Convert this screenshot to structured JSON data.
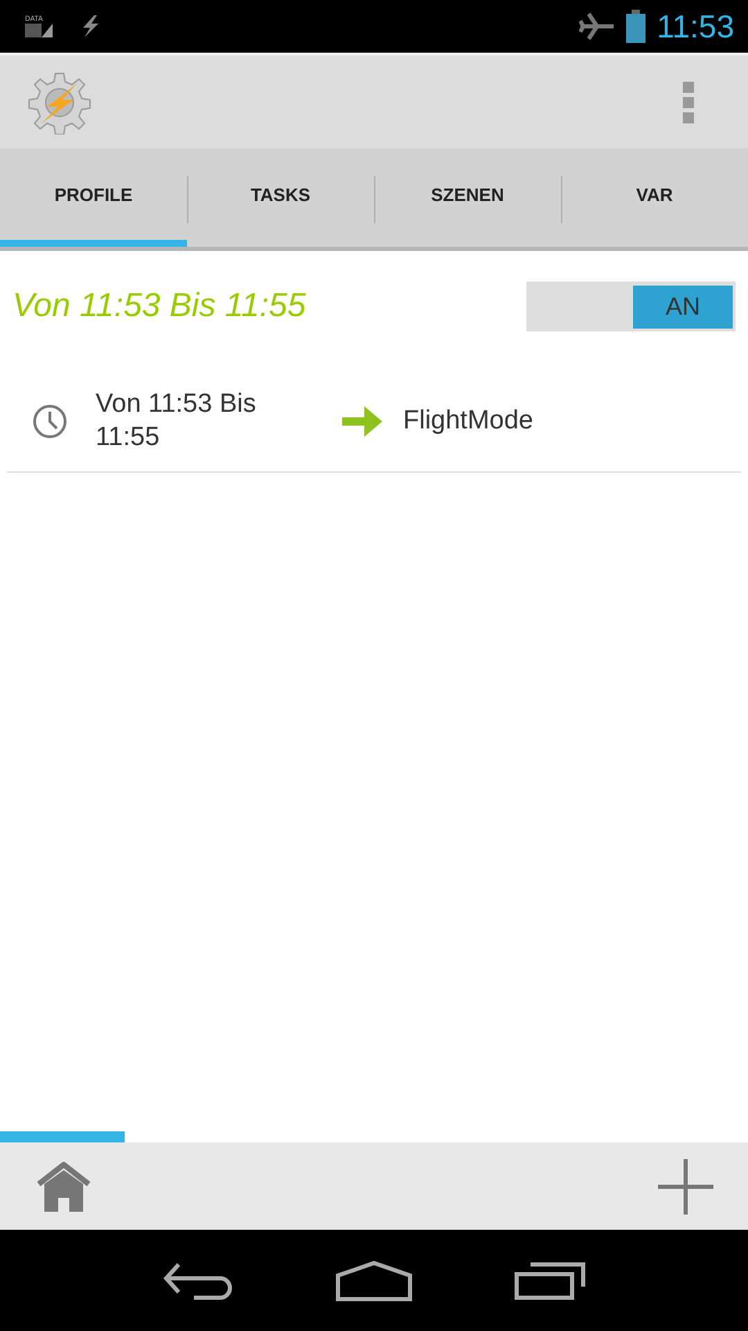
{
  "status_bar": {
    "data_label": "DATA",
    "time": "11:53"
  },
  "tabs": [
    {
      "label": "PROFILE",
      "selected": true
    },
    {
      "label": "TASKS",
      "selected": false
    },
    {
      "label": "SZENEN",
      "selected": false
    },
    {
      "label": "VAR",
      "selected": false
    }
  ],
  "profile": {
    "title": "Von 11:53 Bis 11:55",
    "toggle": {
      "label": "AN",
      "on": true
    },
    "context": "Von 11:53 Bis 11:55",
    "task": "FlightMode"
  }
}
